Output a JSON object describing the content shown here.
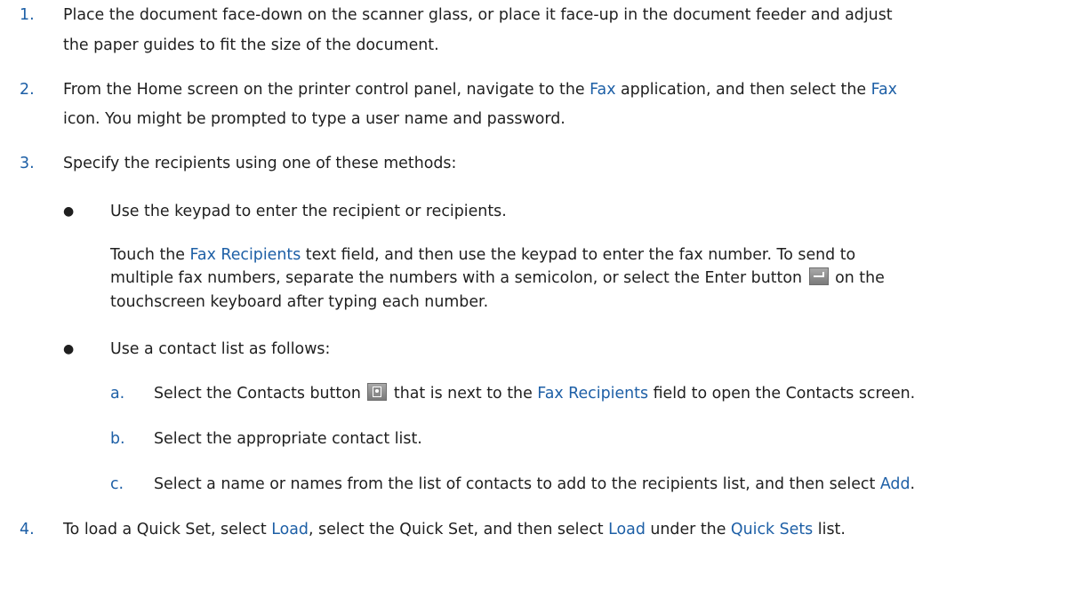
{
  "steps": [
    {
      "num": "1.",
      "line1": "Place the document face-down on the scanner glass, or place it face-up in the document feeder and adjust",
      "line2": "the paper guides to fit the size of the document."
    },
    {
      "num": "2.",
      "l1_a": "From the Home screen on the printer control panel, navigate to the ",
      "l1_link1": "Fax",
      "l1_b": " application, and then select the ",
      "l1_link2": "Fax",
      "line2": "icon. You might be prompted to type a user name and password."
    },
    {
      "num": "3.",
      "line1": "Specify the recipients using one of these methods:"
    },
    {
      "num": "4.",
      "a": "To load a Quick Set, select ",
      "link1": "Load",
      "b": ", select the Quick Set, and then select ",
      "link2": "Load",
      "c": " under the ",
      "link3": "Quick Sets",
      "d": " list."
    }
  ],
  "bullets": [
    {
      "symbol": "●",
      "text": "Use the keypad to enter the recipient or recipients.",
      "para_a": "Touch the ",
      "para_link": "Fax Recipients",
      "para_b": " text field, and then use the keypad to enter the fax number. To send to",
      "para_line2_a": "multiple fax numbers, separate the numbers with a semicolon, or select the Enter button",
      "para_line2_b": "on the",
      "para_line3": "touchscreen keyboard after typing each number.",
      "icon": "enter-key-icon"
    },
    {
      "symbol": "●",
      "text": "Use a contact list as follows:"
    }
  ],
  "substeps": [
    {
      "letter": "a.",
      "a": "Select the Contacts button",
      "b": "that is next to the ",
      "link": "Fax Recipients",
      "c": " field to open the Contacts screen.",
      "icon": "contacts-icon"
    },
    {
      "letter": "b.",
      "text": "Select the appropriate contact list."
    },
    {
      "letter": "c.",
      "a": "Select a name or names from the list of contacts to add to the recipients list, and then select ",
      "link": "Add",
      "b": "."
    }
  ],
  "colors": {
    "link": "#1d5fa6",
    "text": "#1f1f1f"
  }
}
